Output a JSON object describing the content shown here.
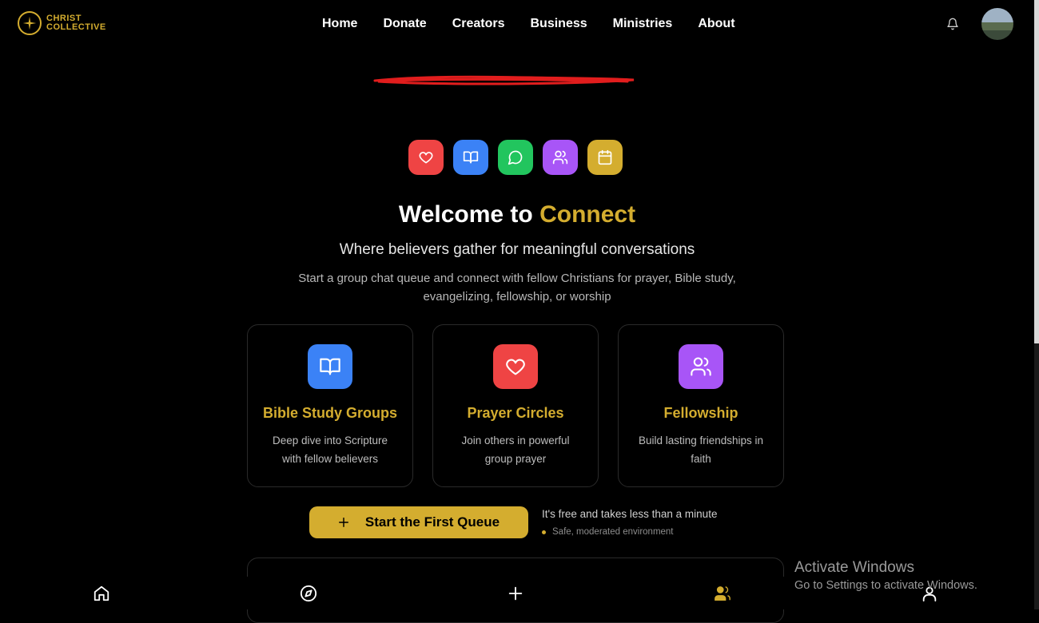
{
  "brand": {
    "line1": "CHRIST",
    "line2": "COLLECTIVE",
    "accent": "#d4ad2f"
  },
  "nav": {
    "items": [
      "Home",
      "Donate",
      "Creators",
      "Business",
      "Ministries",
      "About"
    ]
  },
  "header_icons": {
    "notifications": "bell-icon",
    "profile": "avatar"
  },
  "feature_icons": [
    {
      "name": "heart-icon",
      "color": "#ef4444"
    },
    {
      "name": "book-icon",
      "color": "#3b82f6"
    },
    {
      "name": "chat-icon",
      "color": "#22c55e"
    },
    {
      "name": "users-icon",
      "color": "#a855f7"
    },
    {
      "name": "calendar-icon",
      "color": "#d4ad2f"
    }
  ],
  "hero": {
    "title_prefix": "Welcome to",
    "title_accent": "Connect",
    "subtitle": "Where believers gather for meaningful conversations",
    "description": "Start a group chat queue and connect with fellow Christians for prayer, Bible study, evangelizing, fellowship, or worship"
  },
  "cards": [
    {
      "title": "Bible Study Groups",
      "text": "Deep dive into Scripture with fellow believers",
      "icon": "book-icon",
      "color": "#3b82f6"
    },
    {
      "title": "Prayer Circles",
      "text": "Join others in powerful group prayer",
      "icon": "heart-icon",
      "color": "#ef4444"
    },
    {
      "title": "Fellowship",
      "text": "Build lasting friendships in faith",
      "icon": "users-icon",
      "color": "#a855f7"
    }
  ],
  "cta": {
    "label": "Start the First Queue",
    "note": "It's free and takes less than a minute",
    "safety": "Safe, moderated environment"
  },
  "bottom_nav": [
    "home-icon",
    "compass-icon",
    "plus-icon",
    "users-icon",
    "user-icon"
  ],
  "windows_watermark": {
    "title": "Activate Windows",
    "subtitle": "Go to Settings to activate Windows."
  }
}
